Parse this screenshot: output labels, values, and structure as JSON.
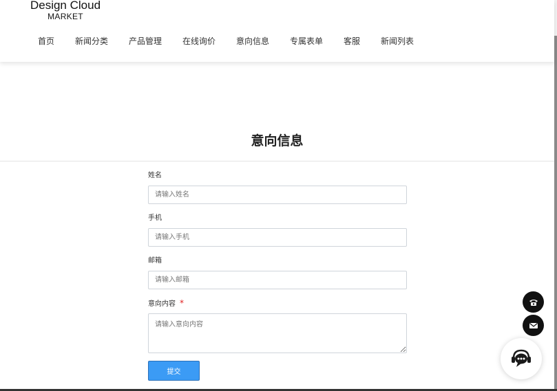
{
  "logo": {
    "main": "Design Cloud",
    "sub": "MARKET"
  },
  "nav": {
    "items": [
      {
        "label": "首页"
      },
      {
        "label": "新闻分类"
      },
      {
        "label": "产品管理"
      },
      {
        "label": "在线询价"
      },
      {
        "label": "意向信息"
      },
      {
        "label": "专属表单"
      },
      {
        "label": "客服"
      },
      {
        "label": "新闻列表"
      }
    ]
  },
  "page_title": "意向信息",
  "form": {
    "name": {
      "label": "姓名",
      "placeholder": "请输入姓名"
    },
    "phone": {
      "label": "手机",
      "placeholder": "请输入手机"
    },
    "email": {
      "label": "邮箱",
      "placeholder": "请输入邮箱"
    },
    "content": {
      "label": "意向内容",
      "required_mark": "*",
      "placeholder": "请输入意向内容"
    },
    "submit_label": "提交"
  },
  "floating": {
    "phone_icon": "phone-icon",
    "mail_icon": "mail-icon",
    "chat_icon": "customer-service-icon"
  },
  "colors": {
    "primary_button": "#3b9bf5",
    "required": "#e02020",
    "float_bg": "#111111"
  }
}
